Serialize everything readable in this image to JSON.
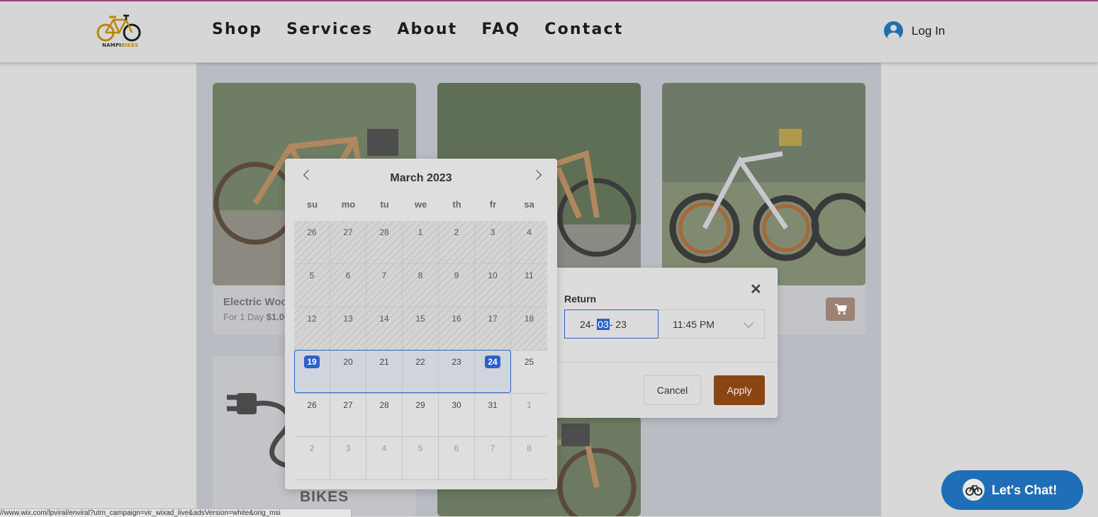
{
  "nav": {
    "logo_text_main": "NAMPI",
    "logo_text_accent": "BIKES",
    "items": [
      "Shop",
      "Services",
      "About",
      "FAQ",
      "Contact"
    ],
    "login_label": "Log In"
  },
  "products": {
    "card1_title": "Electric Wood",
    "card1_price_prefix": "For 1 Day",
    "card1_price_value": "$1.00",
    "bikes_text": "BIKES"
  },
  "return_panel": {
    "label": "Return",
    "date_day": "24",
    "date_month": "03",
    "date_year": "23",
    "time": "11:45 PM",
    "cancel_label": "Cancel",
    "apply_label": "Apply"
  },
  "calendar": {
    "month_title": "March 2023",
    "weekdays": [
      "su",
      "mo",
      "tu",
      "we",
      "th",
      "fr",
      "sa"
    ],
    "weeks": [
      [
        "26",
        "27",
        "28",
        "1",
        "2",
        "3",
        "4"
      ],
      [
        "5",
        "6",
        "7",
        "8",
        "9",
        "10",
        "11"
      ],
      [
        "12",
        "13",
        "14",
        "15",
        "16",
        "17",
        "18"
      ],
      [
        "19",
        "20",
        "21",
        "22",
        "23",
        "24",
        "25"
      ],
      [
        "26",
        "27",
        "28",
        "29",
        "30",
        "31",
        "1"
      ],
      [
        "2",
        "3",
        "4",
        "5",
        "6",
        "7",
        "8"
      ]
    ],
    "range_start": "19",
    "range_end": "24"
  },
  "chat": {
    "label": "Let's Chat!"
  },
  "status_bar": {
    "url": "//www.wix.com/lpviral/enviral?utm_campaign=vir_wixad_live&adsVersion=white&orig_msi"
  },
  "colors": {
    "accent_blue": "#2a62c9",
    "apply_brown": "#8b4513",
    "chat_blue": "#1f6fb8",
    "cart_brown": "#9b8273"
  }
}
